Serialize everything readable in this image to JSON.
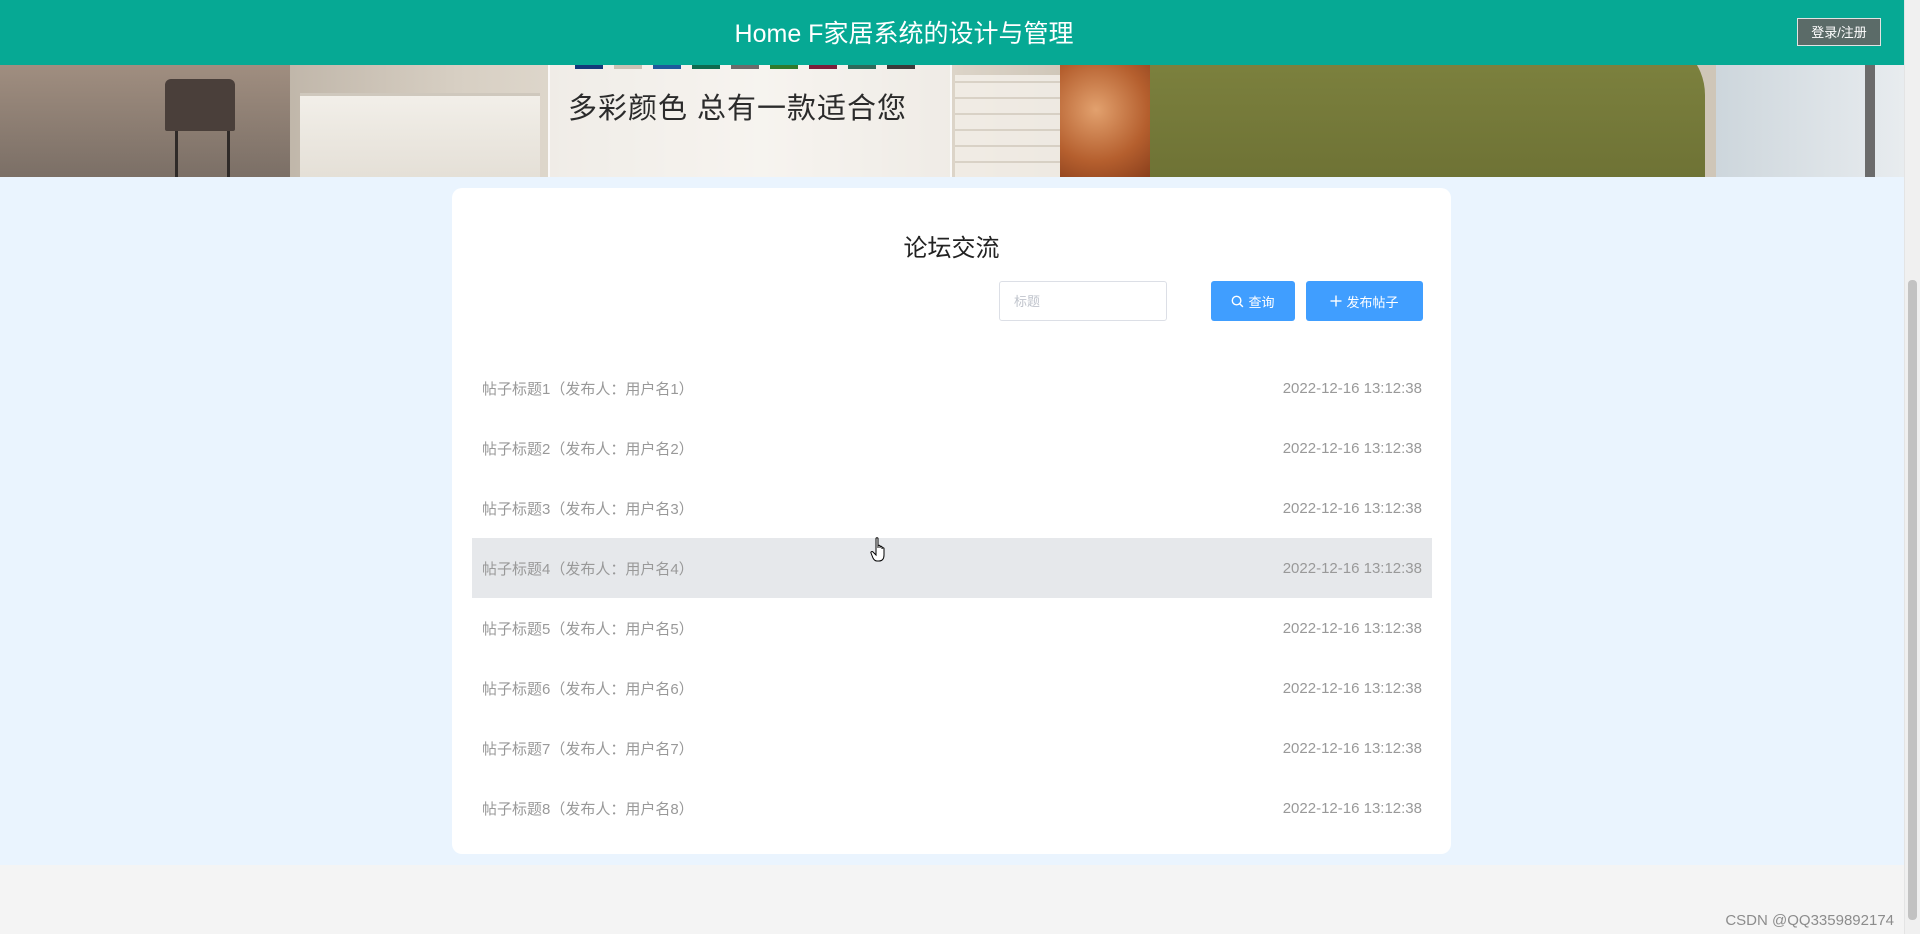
{
  "header": {
    "title": "Home F家居系统的设计与管理",
    "login_label": "登录/注册"
  },
  "banner": {
    "slogan": "多彩颜色  总有一款适合您",
    "swatch_colors": [
      "#123a7a",
      "#c9c2b4",
      "#1d5a9c",
      "#0e6b4f",
      "#6b6b6b",
      "#2f7a2c",
      "#7a1e3a",
      "#2d6a5a",
      "#3a3a3a"
    ]
  },
  "forum": {
    "title": "论坛交流",
    "search": {
      "placeholder": "标题",
      "value": ""
    },
    "search_button": "查询",
    "post_button": "发布帖子",
    "posts": [
      {
        "title": "帖子标题1（发布人：用户名1）",
        "time": "2022-12-16 13:12:38"
      },
      {
        "title": "帖子标题2（发布人：用户名2）",
        "time": "2022-12-16 13:12:38"
      },
      {
        "title": "帖子标题3（发布人：用户名3）",
        "time": "2022-12-16 13:12:38"
      },
      {
        "title": "帖子标题4（发布人：用户名4）",
        "time": "2022-12-16 13:12:38"
      },
      {
        "title": "帖子标题5（发布人：用户名5）",
        "time": "2022-12-16 13:12:38"
      },
      {
        "title": "帖子标题6（发布人：用户名6）",
        "time": "2022-12-16 13:12:38"
      },
      {
        "title": "帖子标题7（发布人：用户名7）",
        "time": "2022-12-16 13:12:38"
      },
      {
        "title": "帖子标题8（发布人：用户名8）",
        "time": "2022-12-16 13:12:38"
      }
    ]
  },
  "watermark": "CSDN @QQ3359892174",
  "colors": {
    "header_bg": "#06a994",
    "primary_button": "#409eff",
    "page_bg": "#eaf4fe",
    "row_hover": "#e6e8eb"
  },
  "icons": [
    "search-icon",
    "plus-icon",
    "hand-cursor-icon"
  ]
}
